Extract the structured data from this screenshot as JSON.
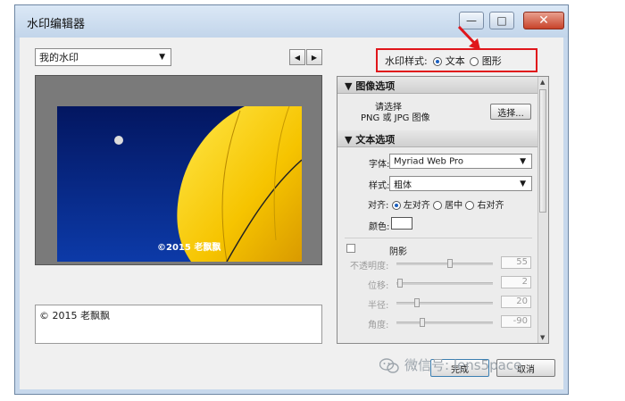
{
  "window": {
    "title": "水印编辑器"
  },
  "window_controls": {
    "minimize": "—",
    "maximize": "□",
    "close": "✕"
  },
  "preset": {
    "selected": "我的水印"
  },
  "nav": {
    "prev": "◀",
    "next": "▶"
  },
  "watermark_style": {
    "label": "水印样式:",
    "options": [
      {
        "label": "文本",
        "selected": true
      },
      {
        "label": "图形",
        "selected": false
      }
    ]
  },
  "preview": {
    "watermark_text": "©2015 老飘飘"
  },
  "text_input": {
    "value": "© 2015 老飘飘"
  },
  "image_options": {
    "header": "图像选项",
    "choose_prompt_line1": "请选择",
    "choose_prompt_line2": "PNG 或 JPG 图像",
    "choose_button": "选择..."
  },
  "text_options": {
    "header": "文本选项",
    "font_label": "字体:",
    "font_value": "Myriad Web Pro",
    "style_label": "样式:",
    "style_value": "粗体",
    "align_label": "对齐:",
    "align_options": [
      {
        "label": "左对齐",
        "selected": true
      },
      {
        "label": "居中",
        "selected": false
      },
      {
        "label": "右对齐",
        "selected": false
      }
    ],
    "color_label": "颜色:"
  },
  "shadow": {
    "label": "阴影",
    "enabled": false,
    "params": [
      {
        "label": "不透明度:",
        "value": "55",
        "level": 0.55
      },
      {
        "label": "位移:",
        "value": "2",
        "level": 0.02
      },
      {
        "label": "半径:",
        "value": "20",
        "level": 0.2
      },
      {
        "label": "角度:",
        "value": "-90",
        "level": 0.25
      }
    ]
  },
  "footer": {
    "ok": "完成",
    "cancel": "取消"
  },
  "overlay_watermark": {
    "text": "微信号: lens5pace"
  },
  "colors": {
    "annotation_red": "#e0161b",
    "sky": "#0a2a8a",
    "balloon": "#f7c800"
  }
}
